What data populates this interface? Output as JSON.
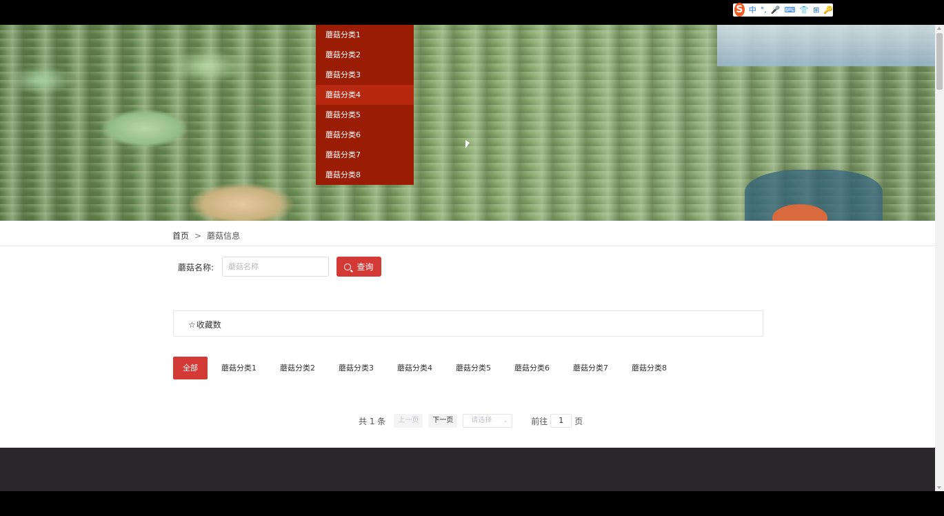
{
  "ime": {
    "logo": "S",
    "items": [
      "中",
      "°,",
      "🎤",
      "⌨",
      "👕",
      "⊞",
      "🔑"
    ]
  },
  "dropdown": {
    "items": [
      "蘑菇分类1",
      "蘑菇分类2",
      "蘑菇分类3",
      "蘑菇分类4",
      "蘑菇分类5",
      "蘑菇分类6",
      "蘑菇分类7",
      "蘑菇分类8"
    ],
    "hover_index": 3
  },
  "breadcrumb": {
    "home": "首页",
    "separator": ">",
    "current": "蘑菇信息"
  },
  "search": {
    "label": "蘑菇名称:",
    "placeholder": "蘑菇名称",
    "value": "",
    "button_label": "查询"
  },
  "sort": {
    "star": "☆",
    "label": "收藏数"
  },
  "categories": {
    "all": "全部",
    "items": [
      "蘑菇分类1",
      "蘑菇分类2",
      "蘑菇分类3",
      "蘑菇分类4",
      "蘑菇分类5",
      "蘑菇分类6",
      "蘑菇分类7",
      "蘑菇分类8"
    ]
  },
  "pagination": {
    "total": "共 1 条",
    "prev": "上一页",
    "next": "下一页",
    "page_size_placeholder": "请选择",
    "goto_prefix": "前往",
    "page": "1",
    "goto_suffix": "页"
  },
  "colors": {
    "accent": "#d33a36",
    "dropdown_bg": "#9b1c04",
    "footer_bg": "#2a272a"
  }
}
